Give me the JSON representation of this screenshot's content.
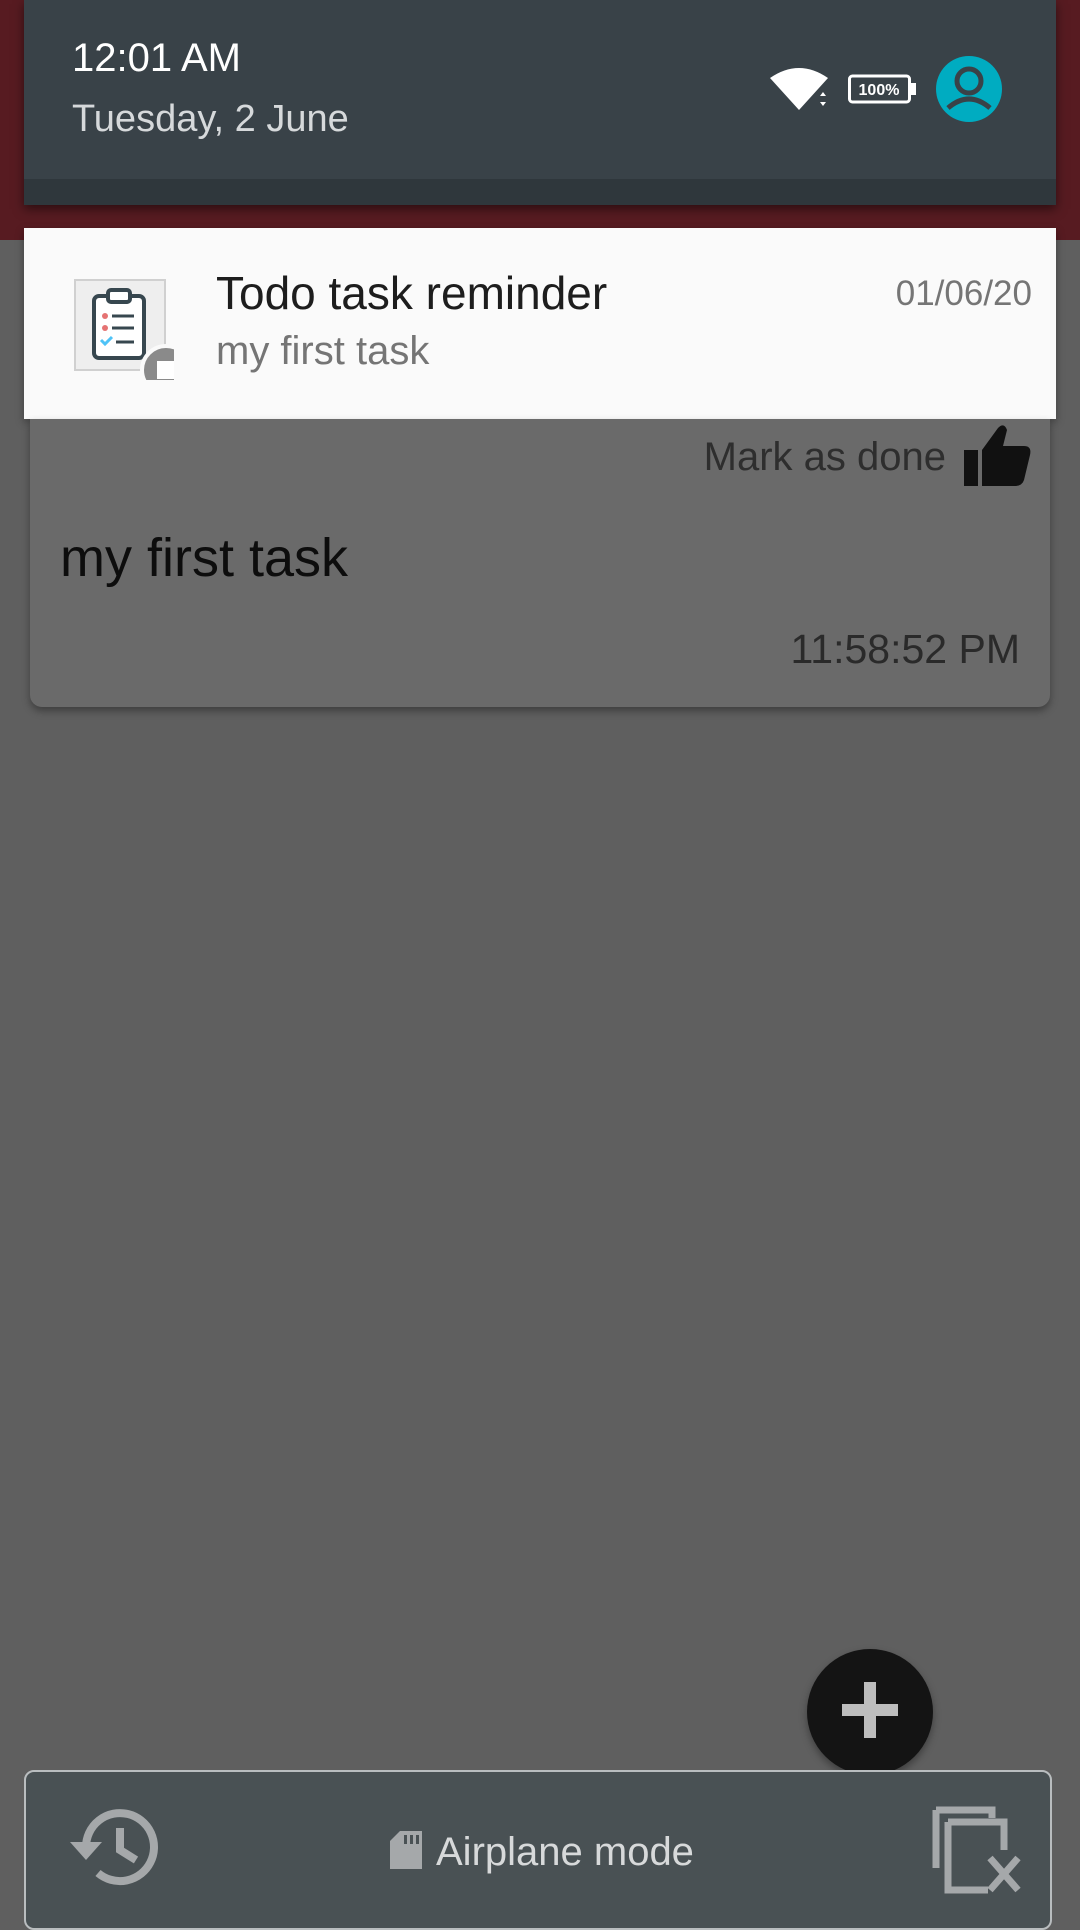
{
  "status": {
    "time": "12:01 AM",
    "date": "Tuesday, 2 June",
    "battery": "100%",
    "icons": [
      "wifi-icon",
      "battery-icon",
      "user-avatar-icon"
    ]
  },
  "notification": {
    "title": "Todo task reminder",
    "text": "my first task",
    "time": "01/06/20",
    "icon": "clipboard-icon"
  },
  "task": {
    "mark_done_label": "Mark as done",
    "title": "my first task",
    "time": "11:58:52 PM"
  },
  "bottom_bar": {
    "airplane_label": "Airplane mode",
    "icons": [
      "history-icon",
      "sd-card-icon",
      "clear-all-icon"
    ]
  },
  "colors": {
    "scrim": "#5f5f5f",
    "app_bar": "#571b21",
    "shade": "#394248",
    "accent_avatar": "#00acc1"
  }
}
